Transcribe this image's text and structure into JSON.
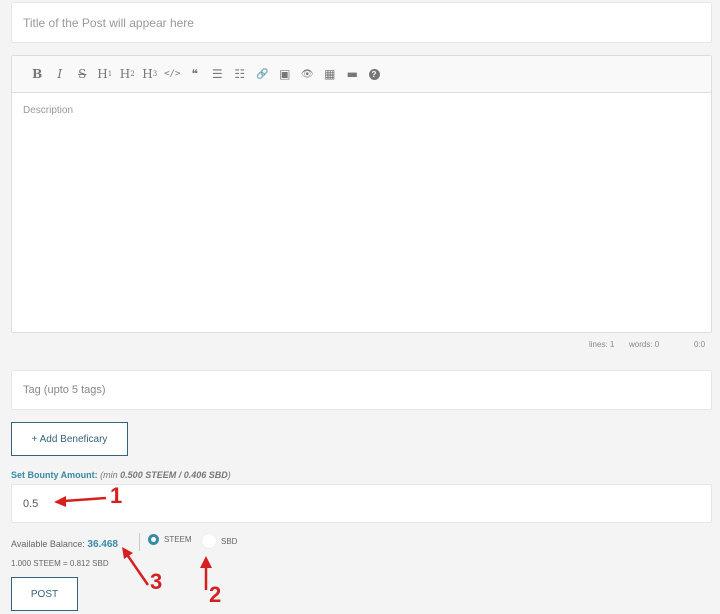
{
  "title_field": {
    "placeholder": "Title of the Post will appear here"
  },
  "toolbar": {
    "items": [
      {
        "name": "bold-icon",
        "glyph": "B"
      },
      {
        "name": "italic-icon",
        "glyph": "I"
      },
      {
        "name": "strikethrough-icon",
        "glyph": "S"
      },
      {
        "name": "heading-1-icon",
        "glyph": "H"
      },
      {
        "name": "heading-2-icon",
        "glyph": "H"
      },
      {
        "name": "heading-3-icon",
        "glyph": "H"
      },
      {
        "name": "code-icon",
        "glyph": "</>"
      },
      {
        "name": "quote-icon",
        "glyph": "❝"
      },
      {
        "name": "unordered-list-icon",
        "glyph": "☰"
      },
      {
        "name": "ordered-list-icon",
        "glyph": "☷"
      },
      {
        "name": "link-icon",
        "glyph": "🔗"
      },
      {
        "name": "image-icon",
        "glyph": "▣"
      },
      {
        "name": "preview-icon",
        "glyph": "👁"
      },
      {
        "name": "table-icon",
        "glyph": "▦"
      },
      {
        "name": "horizontal-rule-icon",
        "glyph": "▬"
      },
      {
        "name": "help-icon",
        "glyph": "?"
      }
    ]
  },
  "editor": {
    "placeholder": "Description",
    "status": {
      "lines": "lines: 1",
      "words": "words: 0",
      "cursor": "0:0"
    }
  },
  "tag_field": {
    "placeholder": "Tag (upto 5 tags)"
  },
  "add_beneficiary_label": "+ Add Beneficary",
  "bounty": {
    "label": "Set Bounty Amount:",
    "hint_prefix": "(min ",
    "hint_values": "0.500 STEEM / 0.406 SBD",
    "hint_suffix": ")",
    "value": "0.5"
  },
  "balance": {
    "label": "Available Balance:",
    "value": "36.468",
    "rate": "1.000 STEEM = 0.812 SBD"
  },
  "currency": {
    "options": [
      "STEEM",
      "SBD"
    ],
    "selected": "STEEM"
  },
  "post_label": "POST",
  "annotations": [
    "1",
    "2",
    "3"
  ],
  "colors": {
    "accent": "#3a8aa6",
    "annotation": "#d62020",
    "button_border": "#34647c"
  }
}
